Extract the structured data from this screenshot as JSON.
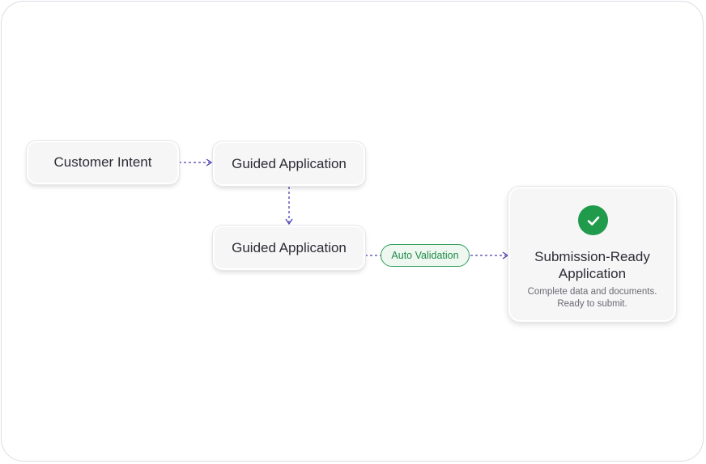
{
  "nodes": {
    "customer_intent": "Customer Intent",
    "guided_application_1": "Guided Application",
    "guided_application_2": "Guided Application"
  },
  "edge_label": "Auto Validation",
  "result": {
    "title": "Submission-Ready\nApplication",
    "subtitle": "Complete data and documents.\nReady to submit.",
    "icon": "check-circle-icon"
  },
  "colors": {
    "arrow": "#4a3fb0",
    "success": "#1f9b4b",
    "pill_border": "#2f9e5a"
  }
}
